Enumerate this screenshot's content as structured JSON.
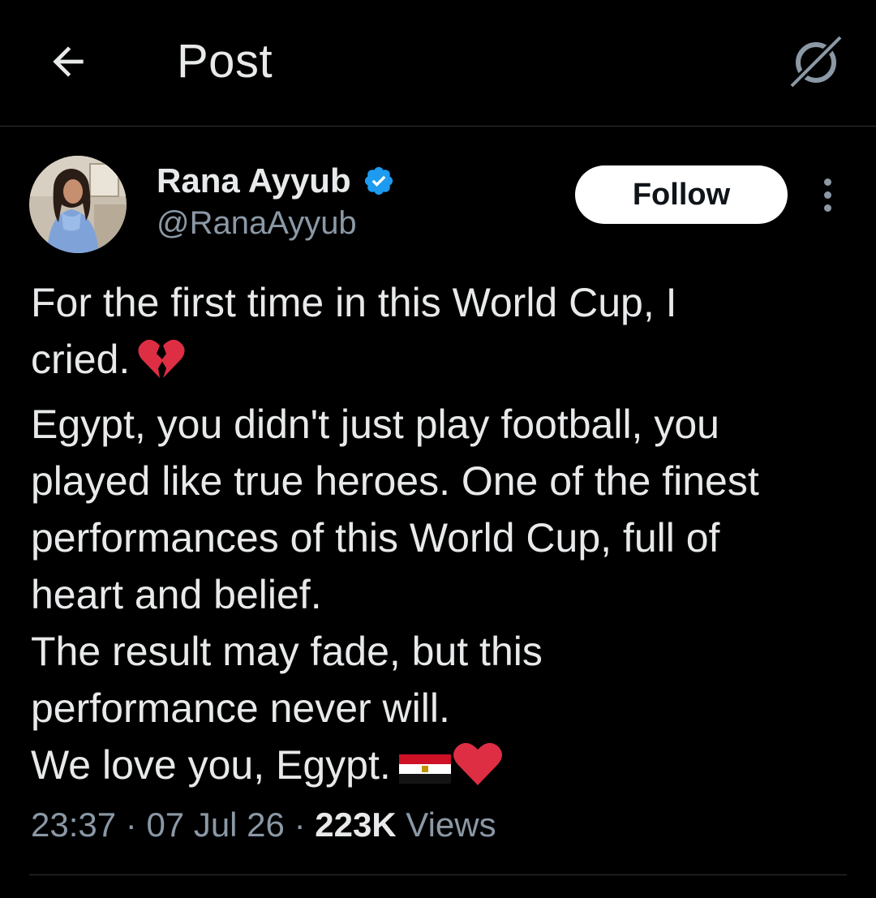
{
  "header": {
    "title": "Post",
    "back_icon": "arrow-left-icon",
    "grok_icon": "grok-icon"
  },
  "author": {
    "display_name": "Rana Ayyub",
    "handle": "@RanaAyyub",
    "verified": true,
    "verified_color": "#1d9bf0",
    "follow_label": "Follow"
  },
  "tweet": {
    "lines": [
      "For the first time in this World Cup, I",
      "cried.",
      "Egypt, you didn't just play football, you",
      "played like true heroes. One of the finest",
      "performances of this World Cup, full of",
      "heart and belief.",
      "The result may fade, but this",
      "performance never will.",
      "We love you, Egypt."
    ],
    "emojis": {
      "cried_line": "broken-heart-emoji",
      "last_line": [
        "egypt-flag-emoji",
        "red-heart-emoji"
      ]
    }
  },
  "meta": {
    "time": "23:37",
    "sep1": " · ",
    "date": "07 Jul 26",
    "sep2": " · ",
    "views_count": "223K",
    "views_label": " Views"
  },
  "colors": {
    "background": "#000000",
    "text_primary": "#e7e9ea",
    "text_secondary": "#8b98a5",
    "divider": "#2f3336"
  }
}
